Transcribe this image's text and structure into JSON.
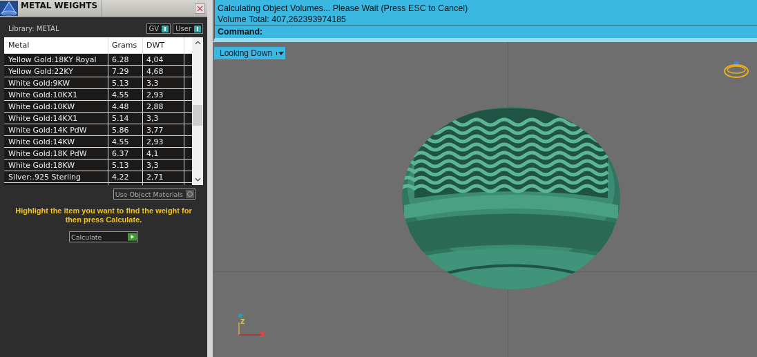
{
  "panel": {
    "title": "METAL WEIGHTS",
    "library": "Library: METAL",
    "toggles": [
      {
        "label": "GV"
      },
      {
        "label": "User"
      }
    ],
    "table": {
      "columns": [
        "Metal",
        "Grams",
        "DWT"
      ],
      "rows": [
        [
          "Yellow Gold:18KY Royal",
          "6.28",
          "4,04"
        ],
        [
          "Yellow Gold:22KY",
          "7.29",
          "4,68"
        ],
        [
          "White Gold:9KW",
          "5.13",
          "3,3"
        ],
        [
          "White Gold:10KX1",
          "4.55",
          "2,93"
        ],
        [
          "White Gold:10KW",
          "4.48",
          "2,88"
        ],
        [
          "White Gold:14KX1",
          "5.14",
          "3,3"
        ],
        [
          "White Gold:14K PdW",
          "5.86",
          "3,77"
        ],
        [
          "White Gold:14KW",
          "4.55",
          "2,93"
        ],
        [
          "White Gold:18K PdW",
          "6.37",
          "4,1"
        ],
        [
          "White Gold:18KW",
          "5.13",
          "3,3"
        ],
        [
          "Silver:.925 Sterling",
          "4.22",
          "2,71"
        ]
      ]
    },
    "use_object_materials": {
      "label": "Use Object Materials",
      "checked": false
    },
    "hint": "Highlight the item you want to find the weight for then press Calculate.",
    "calculate": "Calculate"
  },
  "command": {
    "lines": [
      "Calculating Object Volumes... Please Wait (Press ESC to Cancel)",
      "Volume Total: 407,262393974185"
    ],
    "prompt": "Command:"
  },
  "viewport": {
    "view": "Looking Down",
    "axes": [
      "Z",
      "X"
    ]
  }
}
